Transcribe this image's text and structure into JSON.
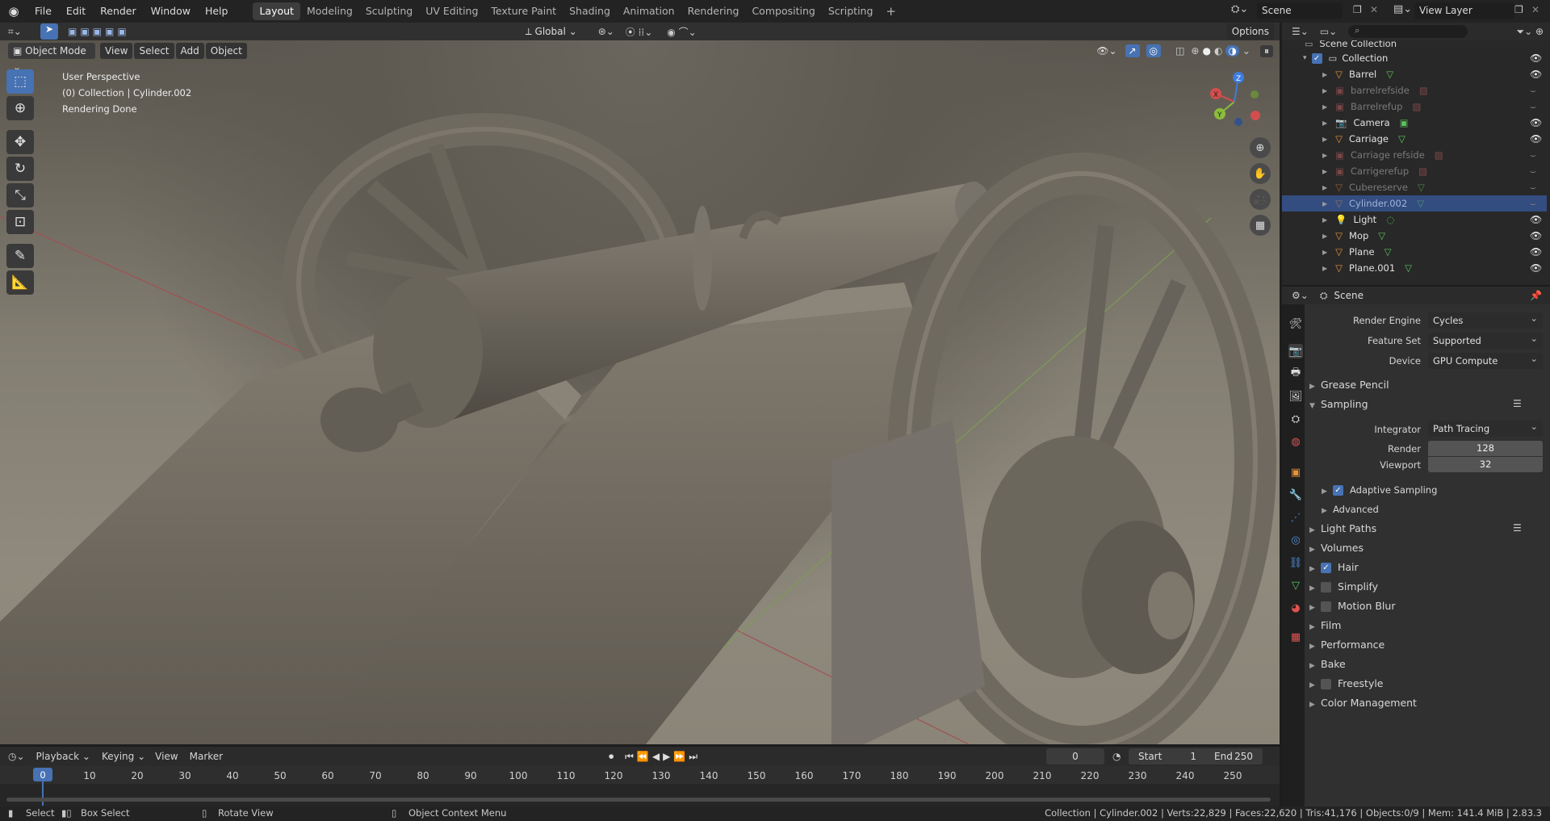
{
  "topbar": {
    "menus": [
      "File",
      "Edit",
      "Render",
      "Window",
      "Help"
    ],
    "workspaces": [
      "Layout",
      "Modeling",
      "Sculpting",
      "UV Editing",
      "Texture Paint",
      "Shading",
      "Animation",
      "Rendering",
      "Compositing",
      "Scripting"
    ],
    "active_workspace": "Layout",
    "add_tab": "+",
    "scene_name": "Scene",
    "view_layer": "View Layer"
  },
  "viewport": {
    "mode": "Object Mode",
    "menus": [
      "View",
      "Select",
      "Add",
      "Object"
    ],
    "orientation": "Global",
    "options": "Options",
    "overlay_lines": [
      "User Perspective",
      "(0) Collection | Cylinder.002",
      "Rendering Done"
    ],
    "gizmo": {
      "z": "Z",
      "y": "Y",
      "x": "X"
    }
  },
  "outliner": {
    "top_label": "Scene Collection",
    "collection": "Collection",
    "items": [
      {
        "name": "Barrel",
        "dim": false,
        "sel": false
      },
      {
        "name": "barrelrefside",
        "dim": true,
        "sel": false
      },
      {
        "name": "Barrelrefup",
        "dim": true,
        "sel": false
      },
      {
        "name": "Camera",
        "dim": false,
        "sel": false
      },
      {
        "name": "Carriage",
        "dim": false,
        "sel": false
      },
      {
        "name": "Carriage refside",
        "dim": true,
        "sel": false
      },
      {
        "name": "Carrigerefup",
        "dim": true,
        "sel": false
      },
      {
        "name": "Cubereserve",
        "dim": true,
        "sel": false
      },
      {
        "name": "Cylinder.002",
        "dim": true,
        "sel": true
      },
      {
        "name": "Light",
        "dim": false,
        "sel": false
      },
      {
        "name": "Mop",
        "dim": false,
        "sel": false
      },
      {
        "name": "Plane",
        "dim": false,
        "sel": false
      },
      {
        "name": "Plane.001",
        "dim": false,
        "sel": false
      }
    ]
  },
  "properties": {
    "context": "Scene",
    "render_engine_label": "Render Engine",
    "render_engine": "Cycles",
    "feature_set_label": "Feature Set",
    "feature_set": "Supported",
    "device_label": "Device",
    "device": "GPU Compute",
    "grease_pencil": "Grease Pencil",
    "sampling": "Sampling",
    "integrator_label": "Integrator",
    "integrator": "Path Tracing",
    "render_label": "Render",
    "render_samples": "128",
    "viewport_label": "Viewport",
    "viewport_samples": "32",
    "adaptive_sampling": "Adaptive Sampling",
    "advanced": "Advanced",
    "light_paths": "Light Paths",
    "volumes": "Volumes",
    "hair": "Hair",
    "simplify": "Simplify",
    "motion_blur": "Motion Blur",
    "film": "Film",
    "performance": "Performance",
    "bake": "Bake",
    "freestyle": "Freestyle",
    "color_management": "Color Management"
  },
  "timeline": {
    "menus": [
      "Playback",
      "Keying",
      "View",
      "Marker"
    ],
    "current_frame": "0",
    "start_label": "Start",
    "start": "1",
    "end_label": "End",
    "end": "250",
    "ticks": [
      "0",
      "10",
      "20",
      "30",
      "40",
      "50",
      "60",
      "70",
      "80",
      "90",
      "100",
      "110",
      "120",
      "130",
      "140",
      "150",
      "160",
      "170",
      "180",
      "190",
      "200",
      "210",
      "220",
      "230",
      "240",
      "250"
    ]
  },
  "statusbar": {
    "select": "Select",
    "box_select": "Box Select",
    "rotate_view": "Rotate View",
    "context_menu": "Object Context Menu",
    "stats": "Collection | Cylinder.002 | Verts:22,829 | Faces:22,620 | Tris:41,176 | Objects:0/9 | Mem: 141.4 MiB | 2.83.3"
  },
  "colors": {
    "accent": "#4772b3",
    "selected_row": "#334d80",
    "wood": "#7a7468"
  }
}
